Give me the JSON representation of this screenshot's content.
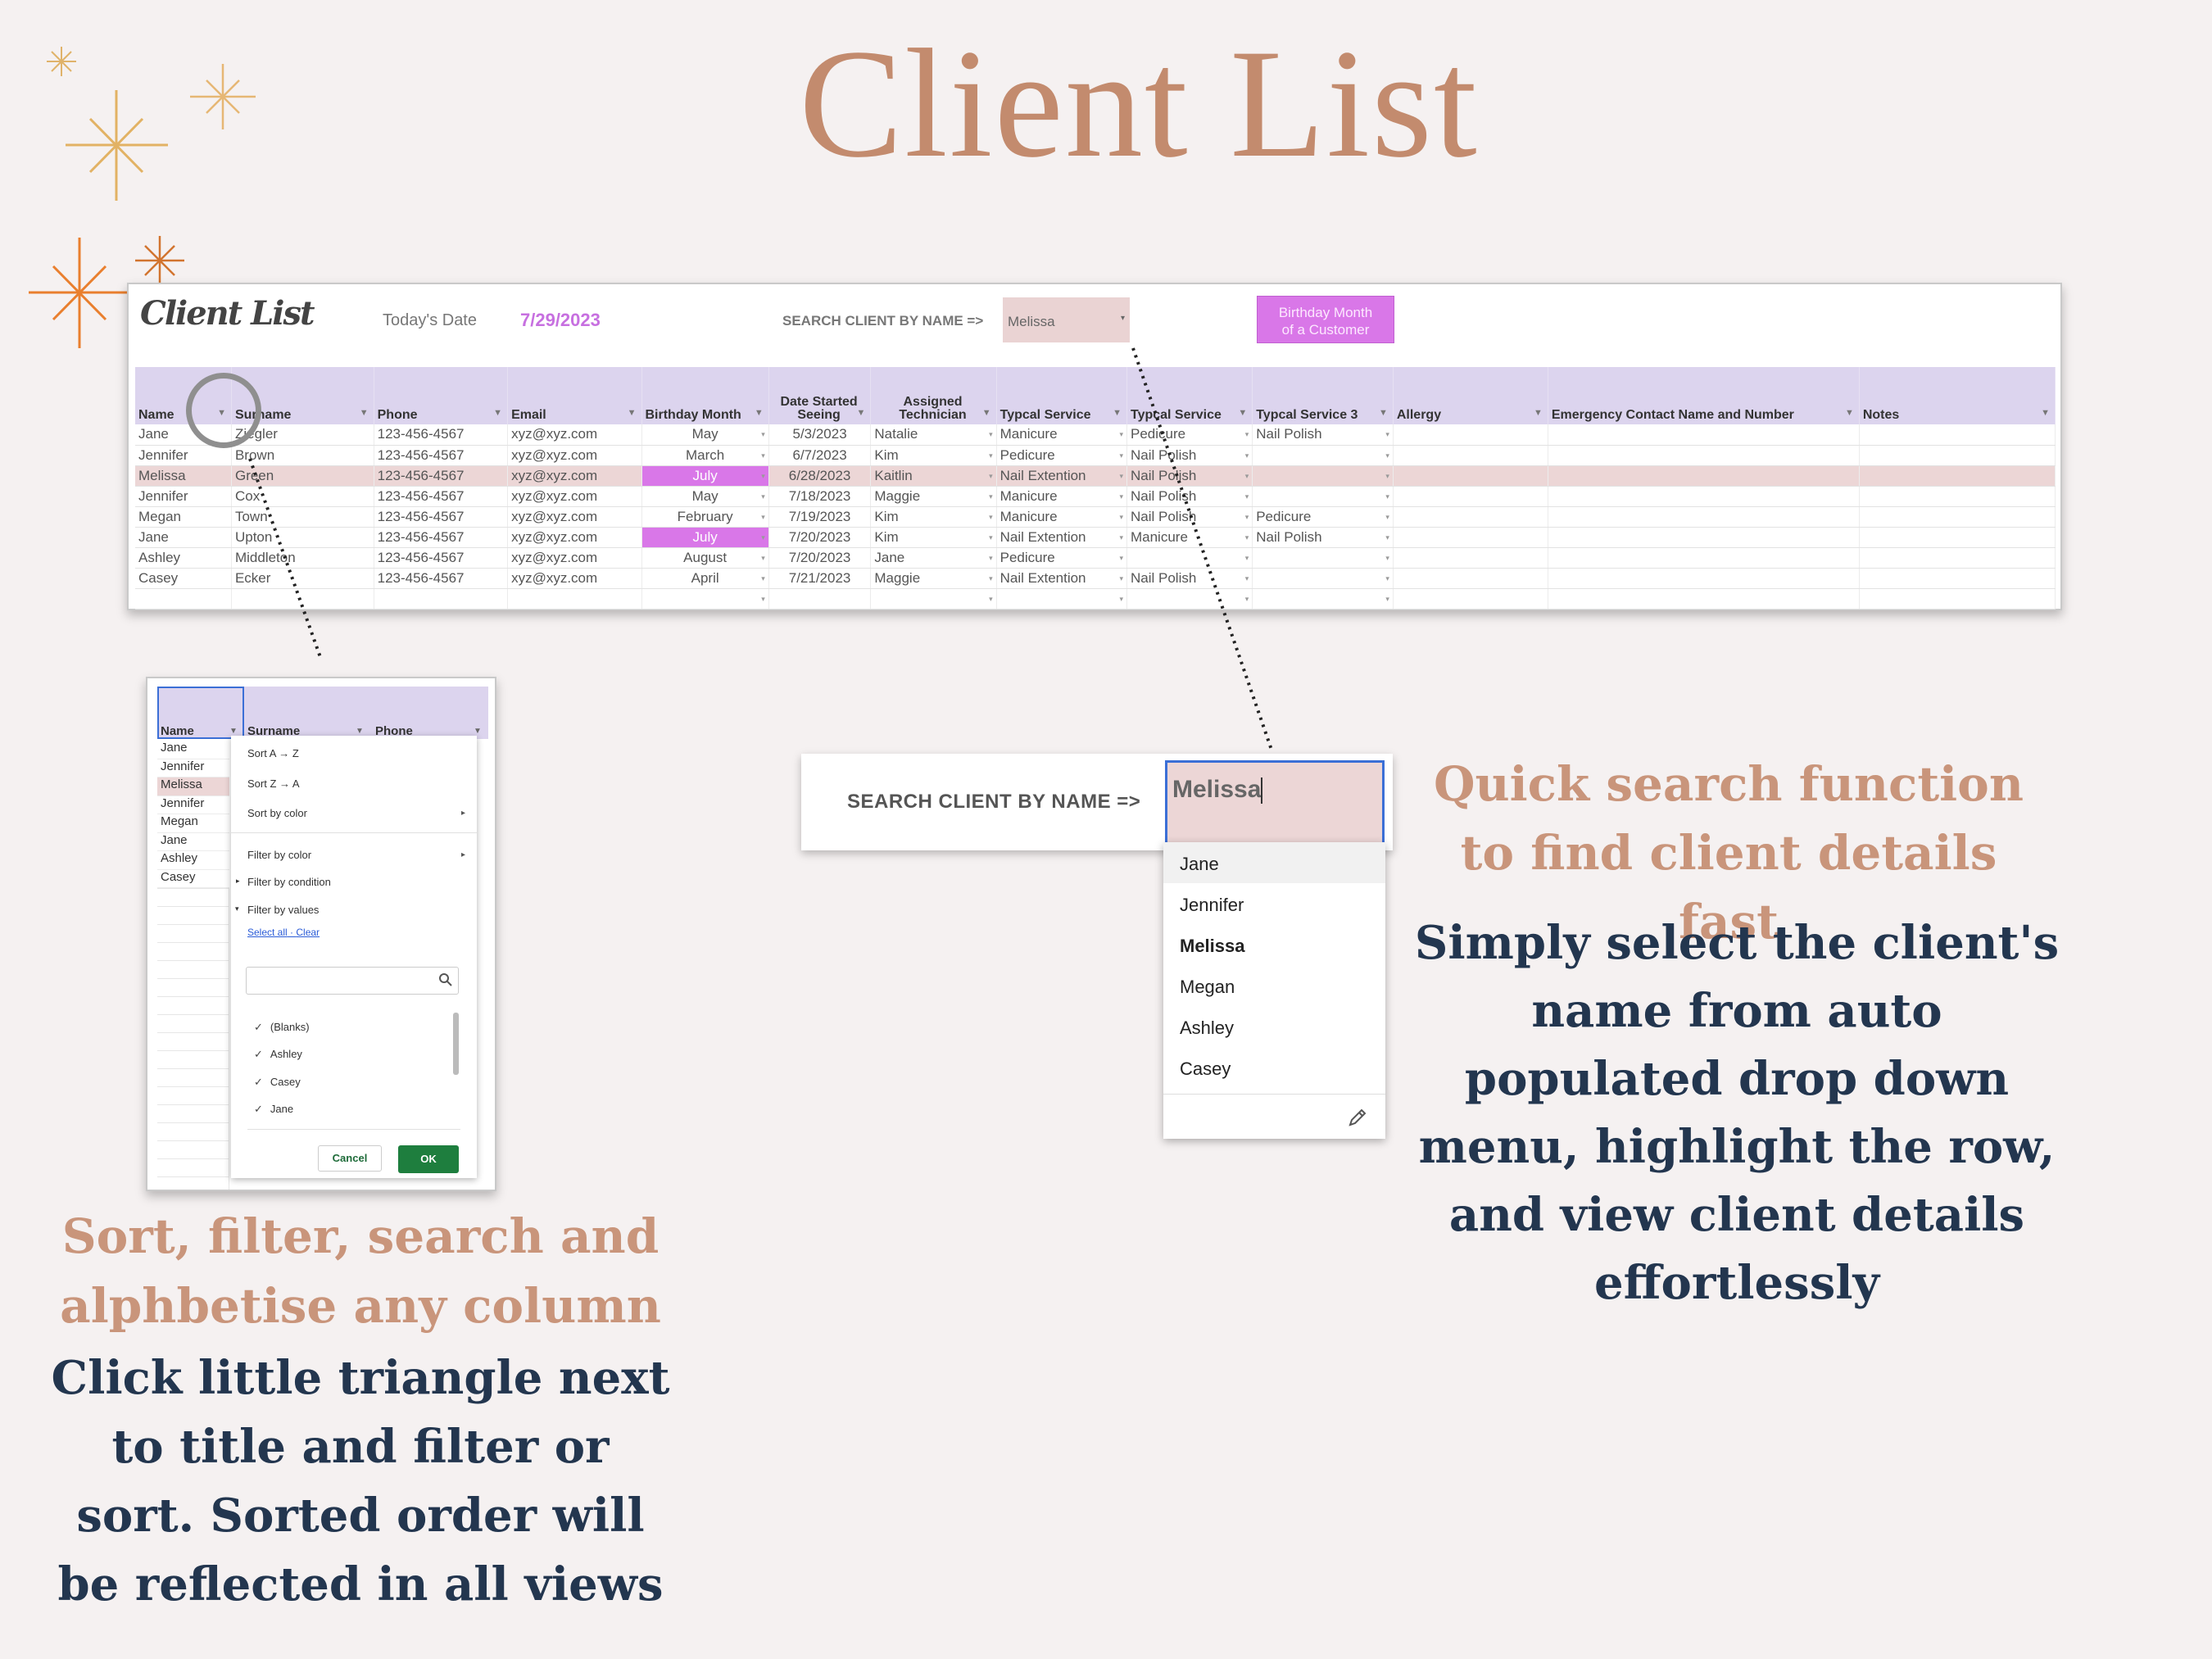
{
  "page": {
    "title": "Client List"
  },
  "sheet": {
    "logo": "Client List",
    "date_label": "Today's Date",
    "date_value": "7/29/2023",
    "search_label": "SEARCH CLIENT BY NAME =>",
    "search_value": "Melissa",
    "birthday_badge": "Birthday Month\nof a Customer",
    "columns": [
      "Name",
      "Surname",
      "Phone",
      "Email",
      "Birthday Month",
      "Date Started Seeing",
      "Assigned Technician",
      "Typcal Service",
      "Typcal Service",
      "Typcal Service 3",
      "Allergy",
      "Emergency Contact Name and Number",
      "Notes"
    ],
    "rows": [
      {
        "name": "Jane",
        "surname": "Ziegler",
        "phone": "123-456-4567",
        "email": "xyz@xyz.com",
        "birthday": "May",
        "started": "5/3/2023",
        "tech": "Natalie",
        "svc1": "Manicure",
        "svc2": "Pedicure",
        "svc3": "Nail Polish",
        "highlight": false,
        "pink": false
      },
      {
        "name": "Jennifer",
        "surname": "Brown",
        "phone": "123-456-4567",
        "email": "xyz@xyz.com",
        "birthday": "March",
        "started": "6/7/2023",
        "tech": "Kim",
        "svc1": "Pedicure",
        "svc2": "Nail Polish",
        "svc3": "",
        "highlight": false,
        "pink": false
      },
      {
        "name": "Melissa",
        "surname": "Green",
        "phone": "123-456-4567",
        "email": "xyz@xyz.com",
        "birthday": "July",
        "started": "6/28/2023",
        "tech": "Kaitlin",
        "svc1": "Nail Extention",
        "svc2": "Nail Polish",
        "svc3": "",
        "highlight": true,
        "pink": true
      },
      {
        "name": "Jennifer",
        "surname": "Cox",
        "phone": "123-456-4567",
        "email": "xyz@xyz.com",
        "birthday": "May",
        "started": "7/18/2023",
        "tech": "Maggie",
        "svc1": "Manicure",
        "svc2": "Nail Polish",
        "svc3": "",
        "highlight": false,
        "pink": false
      },
      {
        "name": "Megan",
        "surname": "Town",
        "phone": "123-456-4567",
        "email": "xyz@xyz.com",
        "birthday": "February",
        "started": "7/19/2023",
        "tech": "Kim",
        "svc1": "Manicure",
        "svc2": "Nail Polish",
        "svc3": "Pedicure",
        "highlight": false,
        "pink": false
      },
      {
        "name": "Jane",
        "surname": "Upton",
        "phone": "123-456-4567",
        "email": "xyz@xyz.com",
        "birthday": "July",
        "started": "7/20/2023",
        "tech": "Kim",
        "svc1": "Nail Extention",
        "svc2": "Manicure",
        "svc3": "Nail Polish",
        "highlight": false,
        "pink": true
      },
      {
        "name": "Ashley",
        "surname": "Middleton",
        "phone": "123-456-4567",
        "email": "xyz@xyz.com",
        "birthday": "August",
        "started": "7/20/2023",
        "tech": "Jane",
        "svc1": "Pedicure",
        "svc2": "",
        "svc3": "",
        "highlight": false,
        "pink": false
      },
      {
        "name": "Casey",
        "surname": "Ecker",
        "phone": "123-456-4567",
        "email": "xyz@xyz.com",
        "birthday": "April",
        "started": "7/21/2023",
        "tech": "Maggie",
        "svc1": "Nail Extention",
        "svc2": "Nail Polish",
        "svc3": "",
        "highlight": false,
        "pink": false
      }
    ]
  },
  "filter_shot": {
    "headers": [
      "Name",
      "Surname",
      "Phone"
    ],
    "names": [
      "Jane",
      "Jennifer",
      "Melissa",
      "Jennifer",
      "Megan",
      "Jane",
      "Ashley",
      "Casey"
    ],
    "menu": {
      "sort_az": "Sort A → Z",
      "sort_za": "Sort Z → A",
      "sort_color": "Sort by color",
      "filter_color": "Filter by color",
      "filter_condition": "Filter by condition",
      "filter_values": "Filter by values",
      "select_all": "Select all",
      "clear": "Clear",
      "values": [
        "(Blanks)",
        "Ashley",
        "Casey",
        "Jane"
      ],
      "cancel": "Cancel",
      "ok": "OK"
    }
  },
  "search_zoom": {
    "label": "SEARCH CLIENT BY NAME =>",
    "value": "Melissa",
    "options": [
      "Jane",
      "Jennifer",
      "Melissa",
      "Megan",
      "Ashley",
      "Casey"
    ],
    "selected": "Melissa"
  },
  "captions": {
    "left_head": "Sort, filter, search and alphbetise any column",
    "left_body": "Click little triangle next to title and filter or sort. Sorted order will be reflected in all views",
    "right_head": "Quick search function to find client details fast",
    "right_body": "Simply select the client's name from auto populated drop down menu, highlight the row, and view client details effortlessly"
  },
  "colors": {
    "title": "#c38b6e",
    "caption_head": "#c9957b",
    "caption_body": "#23364f",
    "header_lavender": "#dcd4ee",
    "row_highlight": "#ecd6d6",
    "birthday_pink": "#d977e8",
    "ok_green": "#1e7e3e"
  }
}
